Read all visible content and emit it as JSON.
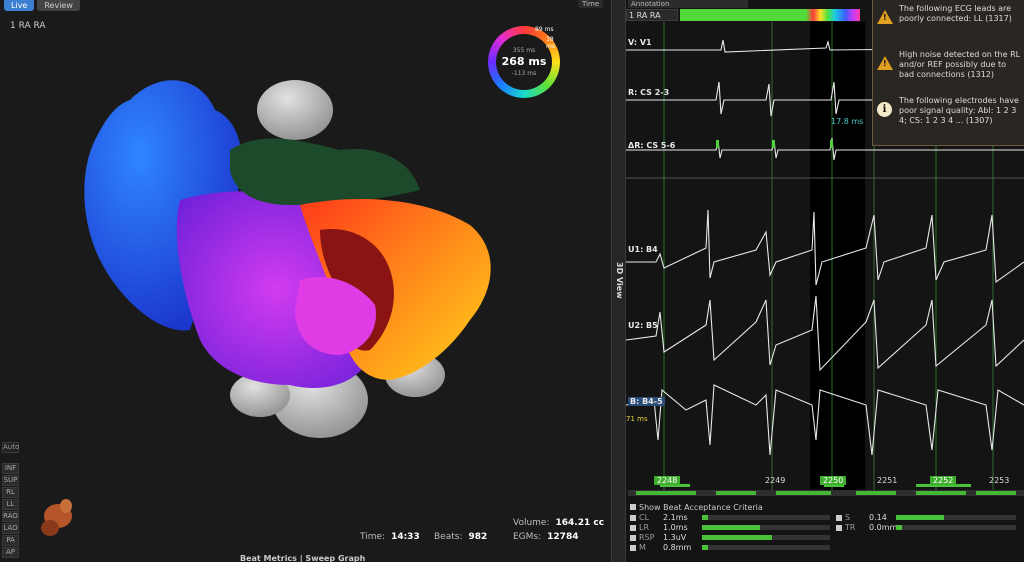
{
  "left_panel": {
    "tabs": [
      {
        "label": "Live",
        "active": true
      },
      {
        "label": "Review",
        "active": false
      }
    ],
    "map_label": "1 RA RA",
    "top_menu": "Time",
    "dial": {
      "top_value": "355 ms",
      "main_value": "268 ms",
      "bottom_value": "-113 ms",
      "arc_left": "89 ms",
      "arc_right": "38 ms"
    },
    "side_tools": [
      "Auto",
      "INF",
      "SUP",
      "RL",
      "LL",
      "RAO",
      "LAO",
      "PA",
      "AP"
    ],
    "stats": {
      "volume_label": "Volume:",
      "volume_value": "164.21 cc",
      "time_label": "Time:",
      "time_value": "14:33",
      "beats_label": "Beats:",
      "beats_value": "982",
      "egms_label": "EGMs:",
      "egms_value": "12784"
    },
    "footer": "Beat Metrics | Sweep Graph"
  },
  "divider_label": "3D View",
  "right_panel": {
    "annotation_label": "Annotation",
    "map_select": "1 RA RA",
    "channels": [
      {
        "label": "V: V1"
      },
      {
        "label": "R: CS 2-3"
      },
      {
        "label": "ΔR: CS 5-6"
      },
      {
        "label": "U1: B4"
      },
      {
        "label": "U2: B5"
      },
      {
        "label": "B: B4-5"
      }
    ],
    "cs_annotation": "17.8 ms",
    "b_annotation": "71 ms",
    "beat_numbers": [
      {
        "label": "2248",
        "highlight": true
      },
      {
        "label": "2249",
        "highlight": false
      },
      {
        "label": "2250",
        "highlight": true
      },
      {
        "label": "2251",
        "highlight": false
      },
      {
        "label": "2252",
        "highlight": true
      },
      {
        "label": "2253",
        "highlight": false
      }
    ],
    "notifications": [
      {
        "type": "warning",
        "text": "The following ECG leads are poorly connected: LL (1317)"
      },
      {
        "type": "warning",
        "text": "High noise detected on the RL and/or REF possibly due to bad connections (1312)"
      },
      {
        "type": "info",
        "text": "The following electrodes have poor signal quality: Abl: 1 2 3 4; CS: 1 2 3 4 ... (1307)"
      }
    ],
    "criteria": {
      "toggle_label": "Show Beat Acceptance Criteria",
      "left": [
        {
          "name": "CL",
          "value": "2.1ms",
          "level": 0.05
        },
        {
          "name": "LR",
          "value": "1.0ms",
          "level": 0.45
        },
        {
          "name": "RSP",
          "value": "1.3uV",
          "level": 0.55
        },
        {
          "name": "M",
          "value": "0.8mm",
          "level": 0.05
        }
      ],
      "right": [
        {
          "name": "S",
          "value": "0.14",
          "level": 0.4
        },
        {
          "name": "TR",
          "value": "0.0mm",
          "level": 0.05
        }
      ]
    }
  }
}
